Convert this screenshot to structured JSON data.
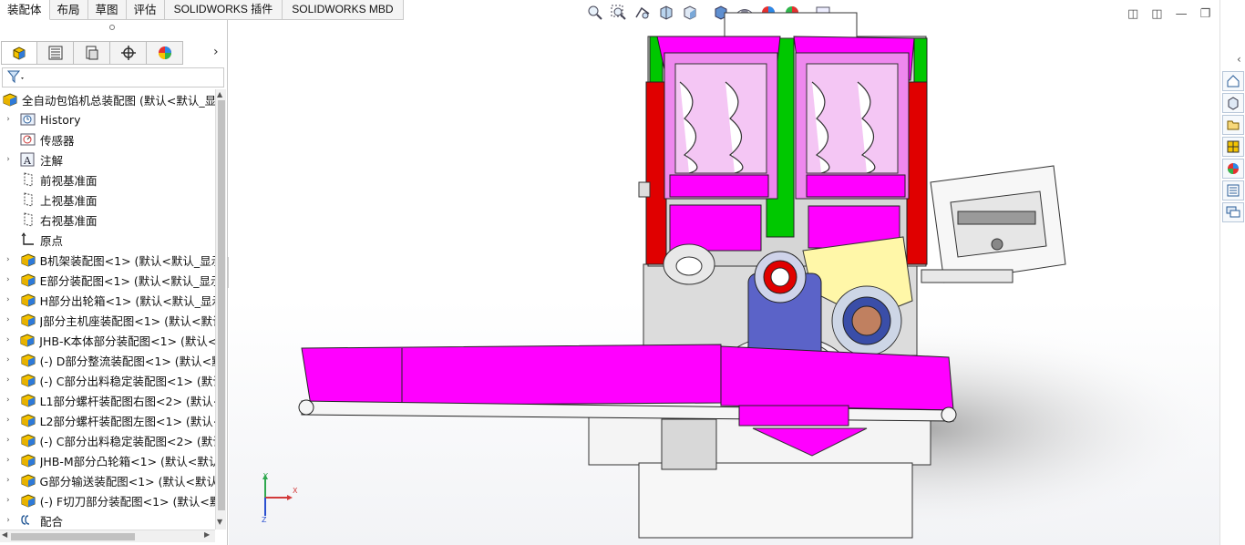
{
  "ribbon_tabs": [
    "装配体",
    "布局",
    "草图",
    "评估",
    "SOLIDWORKS 插件",
    "SOLIDWORKS MBD"
  ],
  "active_tab": "装配体",
  "feature_manager": {
    "panel_tabs": [
      "featuremanager-icon",
      "propertymanager-icon",
      "configurationmanager-icon",
      "dimxpert-icon",
      "display-manager-icon"
    ],
    "root": "全自动包馅机总装配图  (默认<默认_显示",
    "items": [
      {
        "label": "History",
        "icon": "history-icon",
        "arrow": true
      },
      {
        "label": "传感器",
        "icon": "sensor-icon",
        "arrow": false
      },
      {
        "label": "注解",
        "icon": "annotation-icon",
        "arrow": true
      },
      {
        "label": "前视基准面",
        "icon": "plane-icon",
        "arrow": false
      },
      {
        "label": "上视基准面",
        "icon": "plane-icon",
        "arrow": false
      },
      {
        "label": "右视基准面",
        "icon": "plane-icon",
        "arrow": false
      },
      {
        "label": "原点",
        "icon": "origin-icon",
        "arrow": false
      },
      {
        "label": "B机架装配图<1> (默认<默认_显示",
        "icon": "subassembly-icon",
        "arrow": true
      },
      {
        "label": "E部分装配图<1> (默认<默认_显示",
        "icon": "subassembly-icon",
        "arrow": true
      },
      {
        "label": "H部分出轮箱<1> (默认<默认_显示",
        "icon": "subassembly-icon",
        "arrow": true
      },
      {
        "label": "J部分主机座装配图<1> (默认<默认",
        "icon": "subassembly-icon",
        "arrow": true
      },
      {
        "label": "JHB-K本体部分装配图<1> (默认<默",
        "icon": "subassembly-icon",
        "arrow": true
      },
      {
        "label": "(-) D部分整流装配图<1> (默认<默",
        "icon": "subassembly-icon",
        "arrow": true
      },
      {
        "label": "(-) C部分出料稳定装配图<1> (默认",
        "icon": "subassembly-icon",
        "arrow": true
      },
      {
        "label": "L1部分螺杆装配图右图<2> (默认<",
        "icon": "subassembly-icon",
        "arrow": true
      },
      {
        "label": "L2部分螺杆装配图左图<1> (默认<",
        "icon": "subassembly-icon",
        "arrow": true
      },
      {
        "label": "(-) C部分出料稳定装配图<2> (默认",
        "icon": "subassembly-icon",
        "arrow": true
      },
      {
        "label": "JHB-M部分凸轮箱<1> (默认<默认",
        "icon": "subassembly-icon",
        "arrow": true
      },
      {
        "label": "G部分输送装配图<1> (默认<默认_",
        "icon": "subassembly-icon",
        "arrow": true
      },
      {
        "label": "(-) F切刀部分装配图<1> (默认<默",
        "icon": "subassembly-icon",
        "arrow": true
      },
      {
        "label": "配合",
        "icon": "mates-icon",
        "arrow": true
      }
    ]
  },
  "triad": {
    "x": "X",
    "y": "Y",
    "z": "Z"
  },
  "colors": {
    "magenta": "#ff00ff",
    "green": "#00c800",
    "red": "#e00000",
    "yellow": "#fff7a8",
    "blue": "#5b63c8"
  }
}
